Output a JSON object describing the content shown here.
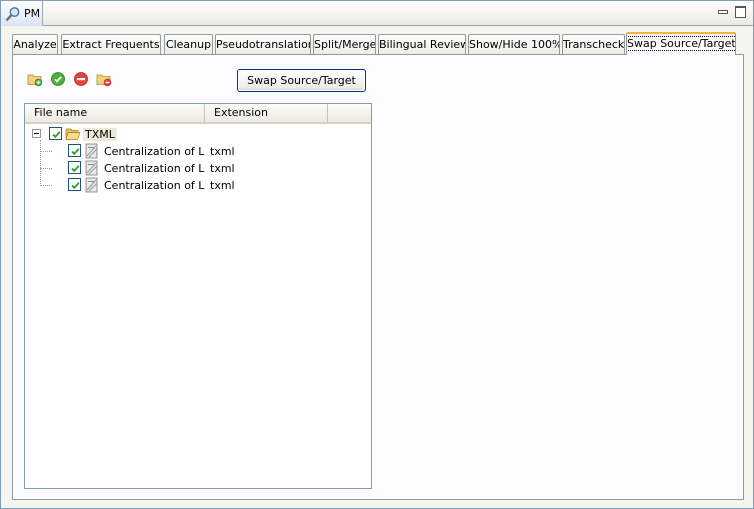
{
  "view": {
    "tab_label": "PM"
  },
  "tabs": [
    {
      "label": "Analyze",
      "active": false
    },
    {
      "label": "Extract Frequents",
      "active": false
    },
    {
      "label": "Cleanup",
      "active": false
    },
    {
      "label": "Pseudotranslation",
      "active": false
    },
    {
      "label": "Split/Merge",
      "active": false
    },
    {
      "label": "Bilingual Review",
      "active": false
    },
    {
      "label": "Show/Hide 100%",
      "active": false
    },
    {
      "label": "Transcheck",
      "active": false
    },
    {
      "label": "Swap Source/Target",
      "active": true
    }
  ],
  "toolbar": {
    "icons": [
      "add-folder-icon",
      "check-all-icon",
      "uncheck-all-icon",
      "remove-folder-icon"
    ],
    "swap_button_label": "Swap Source/Target"
  },
  "tree": {
    "columns": [
      "File name",
      "Extension"
    ],
    "root": {
      "name": "TXML",
      "checked": true,
      "expanded": true
    },
    "files": [
      {
        "name": "Centralization of Loca",
        "extension": "txml",
        "checked": true
      },
      {
        "name": "Centralization of Loca",
        "extension": "txml",
        "checked": true
      },
      {
        "name": "Centralization of Loca",
        "extension": "txml",
        "checked": true
      }
    ]
  },
  "colors": {
    "active_tab_accent": "#f7b045",
    "border": "#7f9db9"
  }
}
